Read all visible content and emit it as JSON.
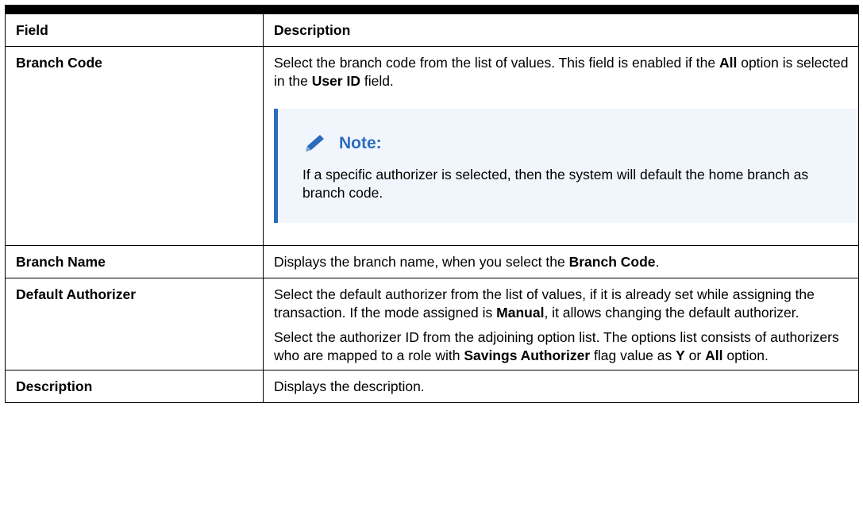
{
  "table": {
    "headers": {
      "field": "Field",
      "description": "Description"
    },
    "rows": [
      {
        "field": "Branch Code",
        "desc_p1": {
          "t1": "Select the branch code from the list of values. This field is enabled if the ",
          "b1": "All",
          "t2": " option is selected in the ",
          "b2": "User ID",
          "t3": " field."
        },
        "note": {
          "icon": "pencil-icon",
          "title": "Note:",
          "text": "If a specific authorizer is selected, then the system will default the home branch as branch code."
        }
      },
      {
        "field": "Branch Name",
        "desc": {
          "t1": "Displays the branch name, when you select the ",
          "b1": "Branch Code",
          "t2": "."
        }
      },
      {
        "field": "Default Authorizer",
        "desc_p1": {
          "t1": "Select the default authorizer from the list of values, if it is already set while assigning the transaction. If the mode assigned is ",
          "b1": "Manual",
          "t2": ", it allows changing the default authorizer."
        },
        "desc_p2": {
          "t1": "Select the authorizer ID from the adjoining option list. The options list consists of authorizers who are mapped to a role with ",
          "b1": "Savings Authorizer",
          "t2": " flag value as ",
          "b2": "Y",
          "t3": " or ",
          "b3": "All",
          "t4": " option."
        }
      },
      {
        "field": "Description",
        "desc": "Displays the description."
      }
    ]
  },
  "colors": {
    "note_accent": "#2c6cbf",
    "note_background": "#f1f6fd",
    "rule": "#000000"
  }
}
